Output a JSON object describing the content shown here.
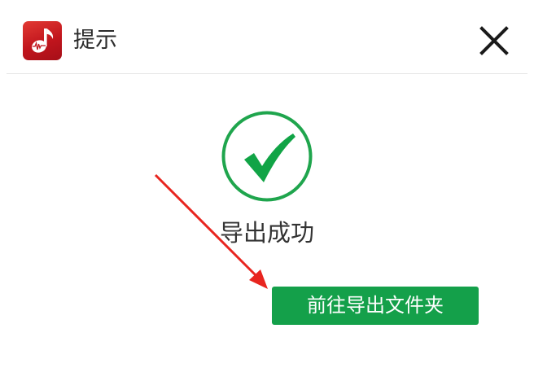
{
  "dialog": {
    "title": "提示",
    "app_icon": "music-note-app-icon",
    "close_icon": "close-icon",
    "status_icon": "check-circle-icon",
    "message": "导出成功",
    "primary_button": "前往导出文件夹"
  },
  "colors": {
    "success_green": "#1fa54d",
    "button_green": "#14a04a",
    "arrow_red": "#e8251f",
    "app_icon_red": "#c1151d"
  }
}
